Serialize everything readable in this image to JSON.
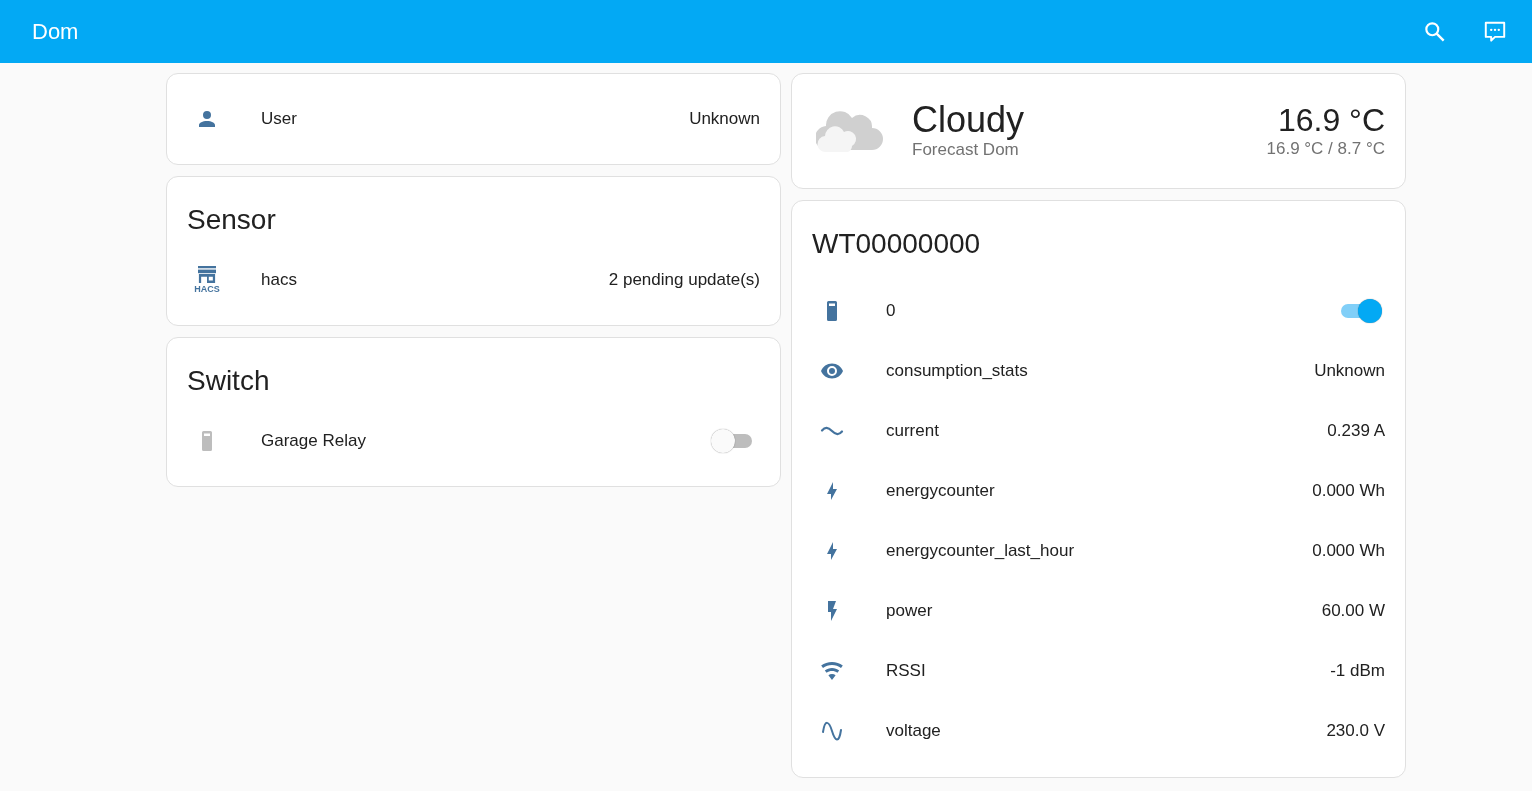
{
  "header": {
    "title": "Dom"
  },
  "left_cards": [
    {
      "rows": [
        {
          "kind": "value",
          "name": "User",
          "value": "Unknown"
        }
      ]
    },
    {
      "title": "Sensor",
      "rows": [
        {
          "icon_label": "HACS",
          "kind": "value",
          "name": "hacs",
          "value": "2 pending update(s)"
        }
      ]
    },
    {
      "title": "Switch",
      "rows": [
        {
          "kind": "toggle",
          "name": "Garage Relay",
          "on": false
        }
      ]
    }
  ],
  "weather": {
    "condition": "Cloudy",
    "subtitle": "Forecast Dom",
    "temperature": "16.9 °C",
    "range": "16.9 °C / 8.7 °C"
  },
  "device_card": {
    "title": "WT00000000",
    "rows": [
      {
        "kind": "toggle",
        "name": "0",
        "on": true
      },
      {
        "kind": "value",
        "name": "consumption_stats",
        "value": "Unknown"
      },
      {
        "kind": "value",
        "name": "current",
        "value": "0.239 A"
      },
      {
        "kind": "value",
        "name": "energycounter",
        "value": "0.000 Wh"
      },
      {
        "kind": "value",
        "name": "energycounter_last_hour",
        "value": "0.000 Wh"
      },
      {
        "kind": "value",
        "name": "power",
        "value": "60.00 W"
      },
      {
        "kind": "value",
        "name": "RSSI",
        "value": "-1 dBm"
      },
      {
        "kind": "value",
        "name": "voltage",
        "value": "230.0 V"
      }
    ]
  }
}
